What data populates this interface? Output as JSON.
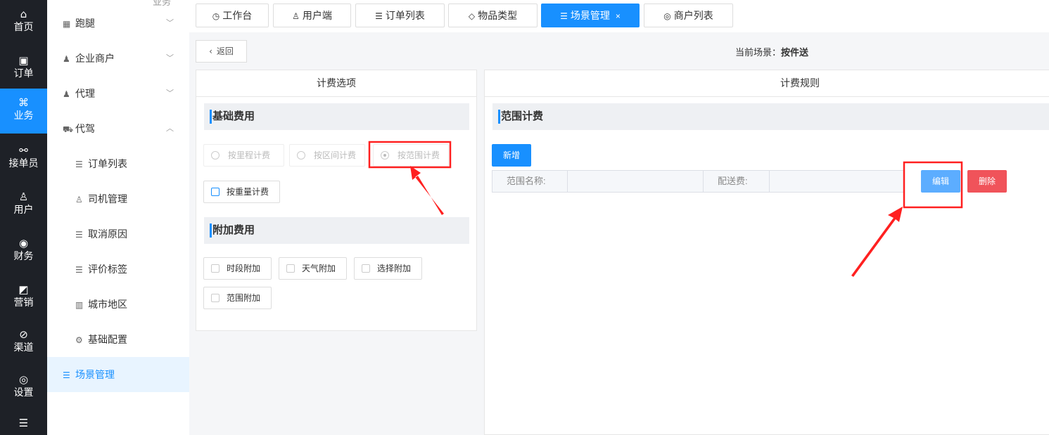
{
  "rail": [
    {
      "label": "首页",
      "icon": "⌂",
      "icon_name": "home-icon"
    },
    {
      "label": "订单",
      "icon": "▣",
      "icon_name": "order-icon"
    },
    {
      "label": "业务",
      "icon": "⌘",
      "icon_name": "business-icon",
      "active": true
    },
    {
      "label": "接单员",
      "icon": "⚯",
      "icon_name": "rider-icon"
    },
    {
      "label": "用户",
      "icon": "♙",
      "icon_name": "user-icon"
    },
    {
      "label": "财务",
      "icon": "◉",
      "icon_name": "finance-icon"
    },
    {
      "label": "营销",
      "icon": "◩",
      "icon_name": "marketing-icon"
    },
    {
      "label": "渠道",
      "icon": "⊘",
      "icon_name": "channel-icon"
    },
    {
      "label": "设置",
      "icon": "◎",
      "icon_name": "settings-icon"
    },
    {
      "label": "",
      "icon": "☰",
      "icon_name": "sliders-icon"
    }
  ],
  "submenu": {
    "top_cut_label": "业务",
    "items": [
      {
        "label": "跑腿",
        "icon": "▦",
        "icon_name": "errand-icon",
        "arrow": "﹀"
      },
      {
        "label": "企业商户",
        "icon": "♟",
        "icon_name": "enterprise-icon",
        "arrow": "﹀"
      },
      {
        "label": "代理",
        "icon": "♟",
        "icon_name": "agent-icon",
        "arrow": "﹀"
      },
      {
        "label": "代驾",
        "icon": "⛟",
        "icon_name": "driver-icon",
        "arrow": "︿"
      },
      {
        "label": "订单列表",
        "icon": "☰",
        "icon_name": "list-icon",
        "child": true
      },
      {
        "label": "司机管理",
        "icon": "♙",
        "icon_name": "driver-manage-icon",
        "child": true
      },
      {
        "label": "取消原因",
        "icon": "☰",
        "icon_name": "list-icon",
        "child": true
      },
      {
        "label": "评价标签",
        "icon": "☰",
        "icon_name": "list-icon",
        "child": true
      },
      {
        "label": "城市地区",
        "icon": "▥",
        "icon_name": "city-icon",
        "child": true
      },
      {
        "label": "基础配置",
        "icon": "⚙",
        "icon_name": "gear-icon",
        "child": true
      },
      {
        "label": "场景管理",
        "icon": "☰",
        "icon_name": "scene-icon",
        "active": true
      }
    ]
  },
  "tabs": [
    {
      "label": "工作台",
      "icon": "◷",
      "icon_name": "dashboard-icon"
    },
    {
      "label": "用户端",
      "icon": "♙",
      "icon_name": "user-icon"
    },
    {
      "label": "订单列表",
      "icon": "☰",
      "icon_name": "list-icon"
    },
    {
      "label": "物品类型",
      "icon": "◇",
      "icon_name": "tag-icon"
    },
    {
      "label": "场景管理",
      "icon": "☰",
      "icon_name": "scene-icon",
      "active": true,
      "close": "×"
    },
    {
      "label": "商户列表",
      "icon": "◎",
      "icon_name": "merchant-icon"
    }
  ],
  "back_label": "返回",
  "back_icon": "‹",
  "scene": {
    "label": "当前场景：",
    "value": "按件送"
  },
  "left_panel": {
    "title": "计费选项",
    "basic_title": "基础费用",
    "basic_options": [
      "按里程计费",
      "按区间计费",
      "按范围计费"
    ],
    "weight_option": "按重量计费",
    "extra_title": "附加费用",
    "extra_options": [
      "时段附加",
      "天气附加",
      "选择附加",
      "范围附加"
    ]
  },
  "right_panel": {
    "title": "计费规则",
    "section_title": "范围计费",
    "add_label": "新增",
    "range_name_label": "范围名称:",
    "fee_label": "配送费:",
    "edit_label": "编辑",
    "delete_label": "删除"
  },
  "colors": {
    "accent": "#1890ff",
    "danger": "#f0535a",
    "annotation": "#ff2020"
  }
}
